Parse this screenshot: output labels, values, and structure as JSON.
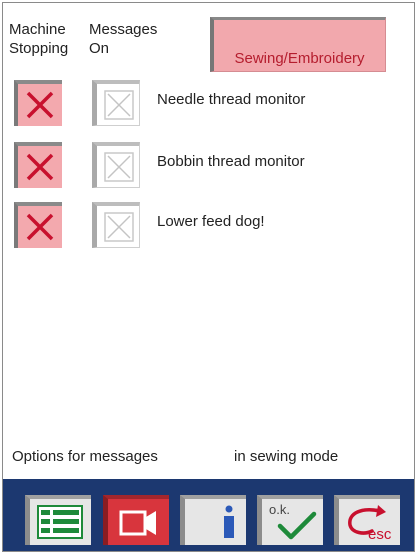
{
  "header": {
    "col_machine": "Machine\nStopping",
    "col_machine_l1": "Machine",
    "col_machine_l2": "Stopping",
    "col_messages_l1": "Messages",
    "col_messages_l2": "On",
    "mode_tab": "Sewing/Embroidery"
  },
  "rows": [
    {
      "label": "Needle thread monitor",
      "stopping": true,
      "message": false
    },
    {
      "label": "Bobbin thread monitor",
      "stopping": true,
      "message": false
    },
    {
      "label": "Lower feed dog!",
      "stopping": true,
      "message": false
    }
  ],
  "footer": {
    "text_left": "Options for messages",
    "text_right": "in sewing mode"
  },
  "toolbar": {
    "ok_label": "o.k.",
    "esc_label": "esc",
    "icons": [
      "list-icon",
      "camera-icon",
      "info-icon",
      "ok-check-icon",
      "esc-return-icon"
    ]
  },
  "colors": {
    "accent_pink": "#f2a8ad",
    "mark_red": "#c8102e",
    "toolbar_blue": "#1c3870",
    "ok_green": "#1e8a3a"
  }
}
